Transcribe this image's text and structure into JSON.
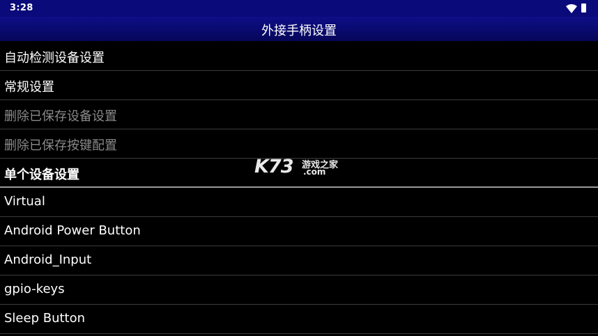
{
  "status_bar": {
    "time": "3:28",
    "wifi_icon": "wifi-icon",
    "battery_icon": "battery-icon"
  },
  "title_bar": {
    "title": "外接手柄设置"
  },
  "menu": {
    "items": [
      {
        "label": "自动检测设备设置",
        "enabled": true
      },
      {
        "label": "常规设置",
        "enabled": true
      },
      {
        "label": "删除已保存设备设置",
        "enabled": false
      },
      {
        "label": "删除已保存按键配置",
        "enabled": false
      }
    ],
    "section_header": "单个设备设置",
    "devices": [
      {
        "label": "Virtual"
      },
      {
        "label": "Android Power Button"
      },
      {
        "label": "Android_Input"
      },
      {
        "label": "gpio-keys"
      },
      {
        "label": "Sleep Button"
      }
    ]
  },
  "watermark": {
    "brand": "K73",
    "site_name": "游戏之家",
    "domain": ".com"
  },
  "colors": {
    "status_bar_bg": "#0a0a7a",
    "title_bar_bg": "#0e0e88",
    "background": "#000000",
    "text": "#ffffff",
    "disabled_text": "#8a8a8a",
    "divider": "#3c3c3c"
  }
}
